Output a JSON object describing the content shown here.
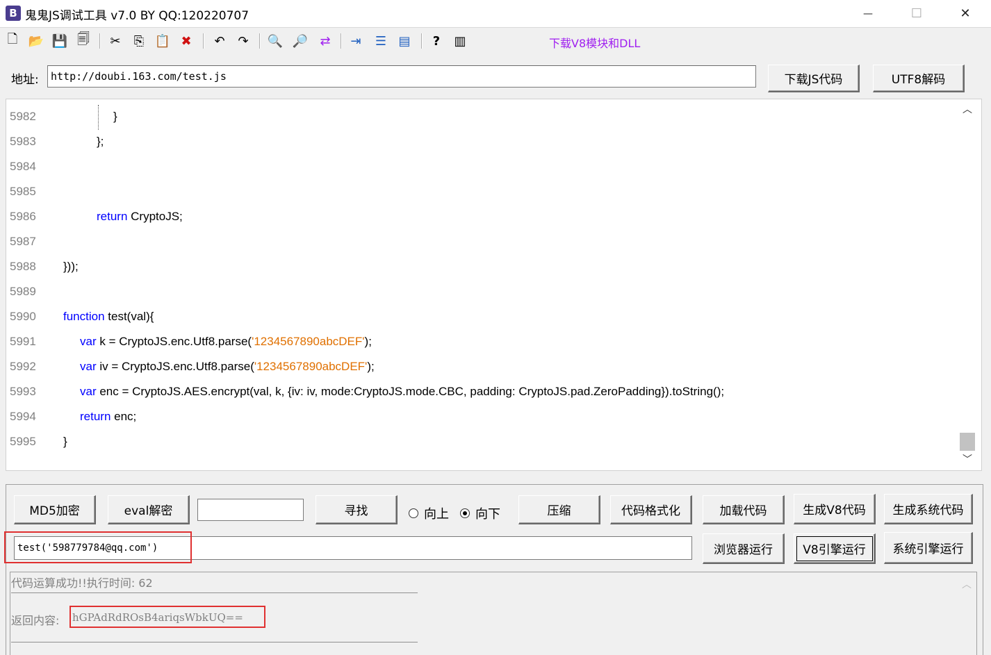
{
  "window": {
    "icon_letter": "B",
    "title": "鬼鬼JS调试工具 v7.0 BY QQ:120220707",
    "minimize_glyph": "—",
    "maximize_glyph": "☐",
    "close_glyph": "✕"
  },
  "toolbar": {
    "icons": [
      {
        "name": "new-file-icon",
        "glyph": "🗋"
      },
      {
        "name": "open-folder-icon",
        "glyph": "📂"
      },
      {
        "name": "save-icon",
        "glyph": "💾"
      },
      {
        "name": "save-all-icon",
        "glyph": "🗐"
      },
      {
        "name": "cut-icon",
        "glyph": "✂"
      },
      {
        "name": "copy-icon",
        "glyph": "⎘"
      },
      {
        "name": "paste-icon",
        "glyph": "📋"
      },
      {
        "name": "delete-icon",
        "glyph": "✖"
      },
      {
        "name": "undo-icon",
        "glyph": "↶"
      },
      {
        "name": "redo-icon",
        "glyph": "↷"
      },
      {
        "name": "find-icon",
        "glyph": "🔍"
      },
      {
        "name": "find-next-icon",
        "glyph": "🔎"
      },
      {
        "name": "replace-icon",
        "glyph": "⇄"
      },
      {
        "name": "indent-icon",
        "glyph": "⇥"
      },
      {
        "name": "numbered-list-icon",
        "glyph": "☰"
      },
      {
        "name": "window-icon",
        "glyph": "▤"
      },
      {
        "name": "help-icon",
        "glyph": "?"
      },
      {
        "name": "column-icon",
        "glyph": "▥"
      }
    ],
    "download_link": "下载V8模块和DLL",
    "download_link_color": "#a020f0"
  },
  "address": {
    "label": "地址:",
    "value": "http://doubi.163.com/test.js",
    "download_button": "下载JS代码",
    "utf8_button": "UTF8解码"
  },
  "editor": {
    "colors": {
      "keyword": "#0000ff",
      "string": "#e07000",
      "line_number": "#808080"
    },
    "lines": [
      {
        "num": "5982",
        "text": "}"
      },
      {
        "num": "5983",
        "text": "};"
      },
      {
        "num": "5984",
        "text": ""
      },
      {
        "num": "5985",
        "text": ""
      },
      {
        "num": "5986",
        "kw": "return",
        "text": " CryptoJS;"
      },
      {
        "num": "5987",
        "text": ""
      },
      {
        "num": "5988",
        "text": "}));"
      },
      {
        "num": "5989",
        "text": ""
      },
      {
        "num": "5990",
        "kw": "function",
        "text": " test(val){"
      },
      {
        "num": "5991",
        "kw": "var",
        "text": " k = CryptoJS.enc.Utf8.parse(",
        "str": "'1234567890abcDEF'",
        "tail": ");"
      },
      {
        "num": "5992",
        "kw": "var",
        "text": " iv = CryptoJS.enc.Utf8.parse(",
        "str": "'1234567890abcDEF'",
        "tail": ");"
      },
      {
        "num": "5993",
        "kw": "var",
        "text": " enc = CryptoJS.AES.encrypt(val, k, {iv: iv, mode:CryptoJS.mode.CBC, padding: CryptoJS.pad.ZeroPadding}).toString();"
      },
      {
        "num": "5994",
        "kw": "return",
        "text": " enc;"
      },
      {
        "num": "5995",
        "text": "}"
      }
    ],
    "scroll_up": "︿",
    "scroll_down": "﹀"
  },
  "controls": {
    "md5_button": "MD5加密",
    "eval_button": "eval解密",
    "search_value": "",
    "find_button": "寻找",
    "radio_up": "向上",
    "radio_down": "向下",
    "selected_direction": "向下",
    "compress_button": "压缩",
    "format_button": "代码格式化",
    "load_button": "加载代码",
    "gen_v8_button": "生成V8代码",
    "gen_sys_button": "生成系统代码",
    "call_value": "test('598779784@qq.com')",
    "browser_run_button": "浏览器运行",
    "v8_run_button": "V8引擎运行",
    "sys_run_button": "系统引擎运行"
  },
  "output": {
    "status": "代码运算成功!!执行时间: 62",
    "return_label": "返回内容:",
    "return_value": "hGPAdRdROsB4ariqsWbkUQ==",
    "scroll_up": "︿"
  }
}
